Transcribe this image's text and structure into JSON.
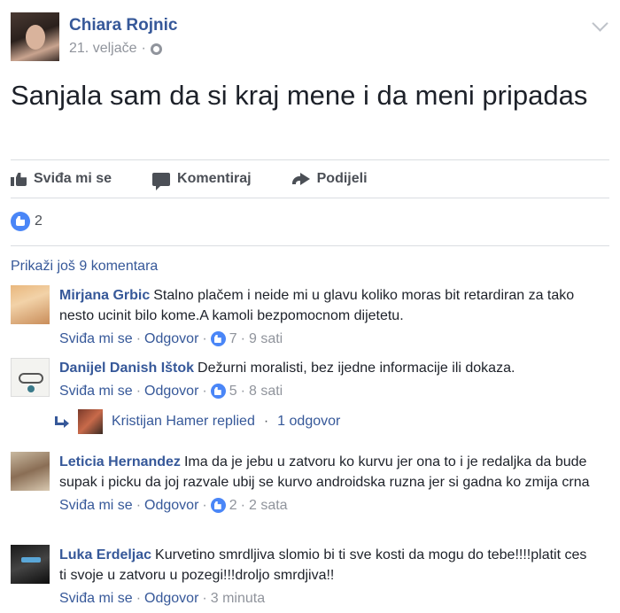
{
  "post": {
    "author": "Chiara Rojnic",
    "date": "21. veljače",
    "separator": "·",
    "text": "Sanjala sam da si kraj mene i da meni pripadas"
  },
  "actions": {
    "like": "Sviđa mi se",
    "comment": "Komentiraj",
    "share": "Podijeli"
  },
  "reactions": {
    "count": "2"
  },
  "more_comments": "Prikaži još 9 komentara",
  "comment_labels": {
    "like": "Sviđa mi se",
    "reply": "Odgovor",
    "dot": "·"
  },
  "comments": [
    {
      "name": "Mirjana Grbic",
      "text": "Stalno plačem i neide mi u glavu koliko moras bit retardiran za tako nesto ucinit bilo kome.A kamoli bezpomocnom dijetetu.",
      "likes": "7",
      "time": "9 sati"
    },
    {
      "name": "Danijel Danish Ištok",
      "text": "Dežurni moralisti, bez ijedne informacije ili dokaza.",
      "likes": "5",
      "time": "8 sati"
    },
    {
      "name": "Leticia Hernandez",
      "text": "Ima da je jebu u zatvoru ko kurvu jer ona to i je redaljka da bude supak i picku da joj razvale ubij se kurvo androidska ruzna jer si gadna ko zmija crna",
      "likes": "2",
      "time": "2 sata"
    },
    {
      "name": "Luka Erdeljac",
      "text": "Kurvetino smrdljiva slomio bi ti sve kosti da mogu do tebe!!!!platit ces ti svoje u zatvoru u pozegi!!!droljo smrdjiva!!",
      "time": "3 minuta"
    }
  ],
  "reply": {
    "text": "Kristijan Hamer replied",
    "separator": "·",
    "count": "1 odgovor"
  },
  "colors": {
    "link": "#365899",
    "meta": "#90949c",
    "like_blue": "#4a86f7"
  }
}
